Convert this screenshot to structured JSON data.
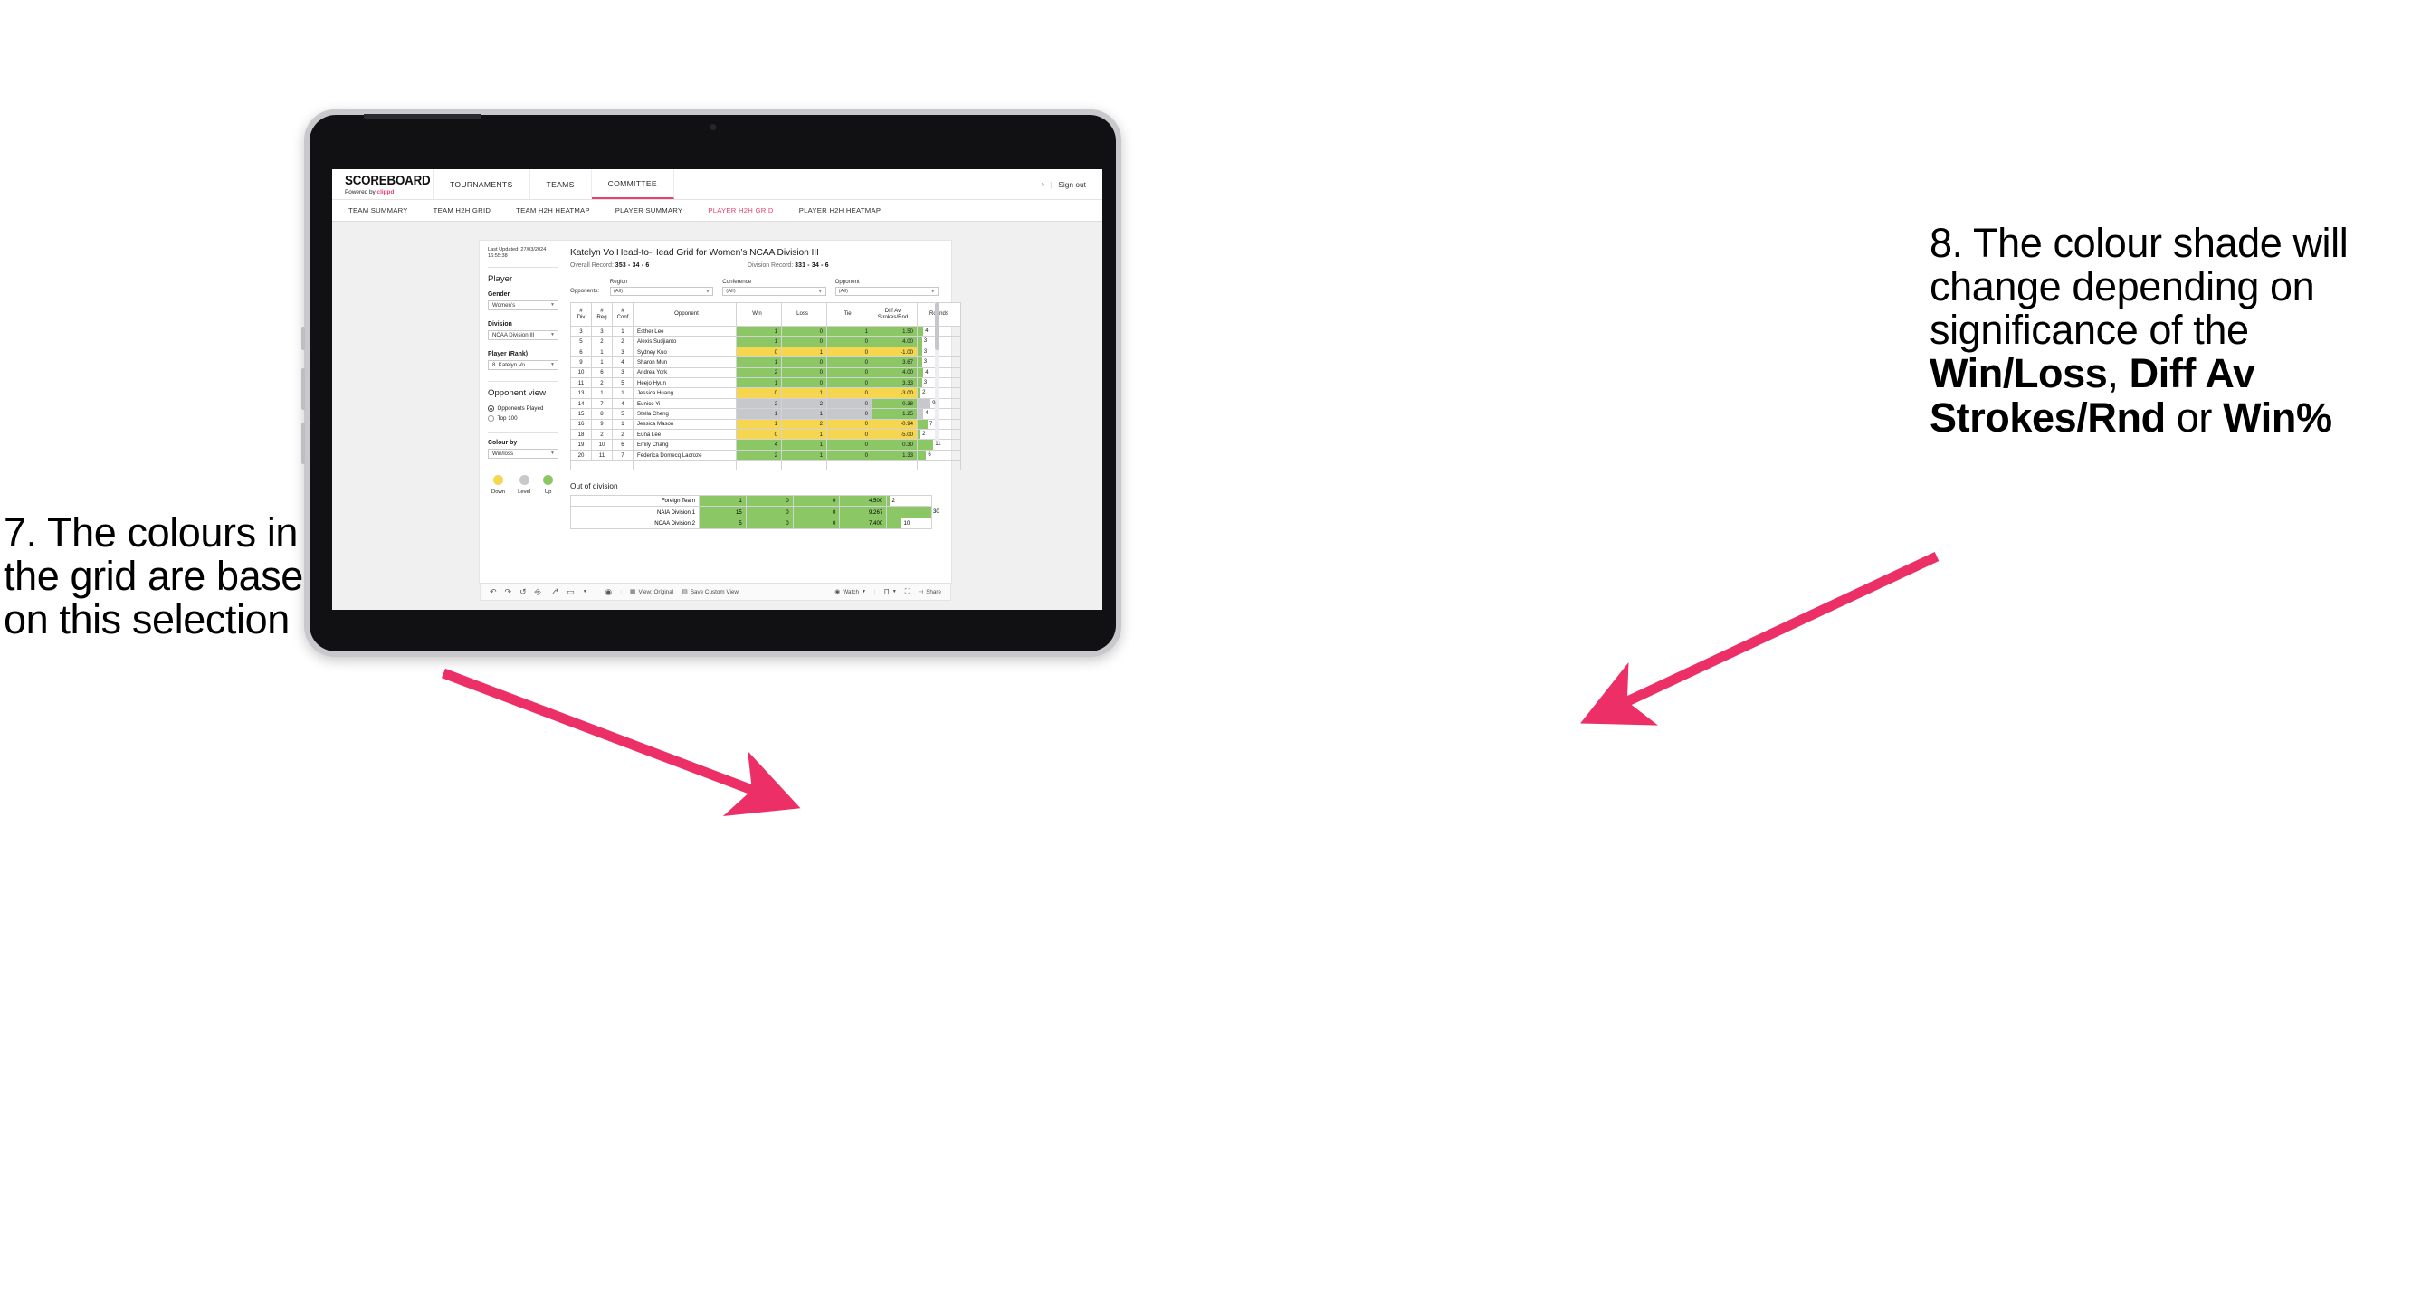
{
  "annotations": {
    "left": {
      "lines": [
        "7. The colours in",
        "the grid are based",
        "on this selection"
      ]
    },
    "right": {
      "segments": [
        {
          "text": "8. The colour shade will change depending on significance of the ",
          "bold": false
        },
        {
          "text": "Win/Loss",
          "bold": true
        },
        {
          "text": ", ",
          "bold": false
        },
        {
          "text": "Diff Av Strokes/Rnd",
          "bold": true
        },
        {
          "text": " or ",
          "bold": false
        },
        {
          "text": "Win%",
          "bold": true
        }
      ]
    },
    "arrow_color": "#ec2f66"
  },
  "app": {
    "brand": {
      "title": "SCOREBOARD",
      "powered_prefix": "Powered by ",
      "powered_name": "clippd"
    },
    "top_nav": [
      {
        "label": "TOURNAMENTS",
        "active": false
      },
      {
        "label": "TEAMS",
        "active": false
      },
      {
        "label": "COMMITTEE",
        "active": true
      }
    ],
    "top_right": {
      "chevron": "›",
      "separator": "|",
      "sign_out": "Sign out"
    },
    "sub_nav": [
      {
        "label": "TEAM SUMMARY",
        "active": false
      },
      {
        "label": "TEAM H2H GRID",
        "active": false
      },
      {
        "label": "TEAM H2H HEATMAP",
        "active": false
      },
      {
        "label": "PLAYER SUMMARY",
        "active": false
      },
      {
        "label": "PLAYER H2H GRID",
        "active": true
      },
      {
        "label": "PLAYER H2H HEATMAP",
        "active": false
      }
    ],
    "accent_color": "#e8416b"
  },
  "panel": {
    "last_updated_line1": "Last Updated: 27/03/2024",
    "last_updated_line2": "16:55:38",
    "heading": "Player",
    "fields": [
      {
        "label": "Gender",
        "value": "Women’s"
      },
      {
        "label": "Division",
        "value": "NCAA Division III"
      },
      {
        "label": "Player (Rank)",
        "value": "8. Katelyn Vo"
      }
    ],
    "opponent_view": {
      "heading": "Opponent view",
      "options": [
        {
          "label": "Opponents Played",
          "selected": true
        },
        {
          "label": "Top 100",
          "selected": false
        }
      ]
    },
    "colour_by": {
      "label": "Colour by",
      "value": "Win/loss"
    },
    "legend": [
      {
        "label": "Down",
        "color": "#f5d64e"
      },
      {
        "label": "Level",
        "color": "#c6c8cc"
      },
      {
        "label": "Up",
        "color": "#8cc765"
      }
    ]
  },
  "main": {
    "title": "Katelyn Vo Head-to-Head Grid for Women’s NCAA Division III",
    "overall_record_label": "Overall Record: ",
    "overall_record_value": "353 -  34 - 6",
    "division_record_label": "Division Record: ",
    "division_record_value": "331 -  34 - 6",
    "opponents_label": "Opponents:",
    "filters": [
      {
        "label": "Region",
        "value": "(All)"
      },
      {
        "label": "Conference",
        "value": "(All)"
      },
      {
        "label": "Opponent",
        "value": "(All)"
      }
    ]
  },
  "chart_data": {
    "type": "table",
    "title": "Katelyn Vo Head-to-Head Grid for Women’s NCAA Division III",
    "columns": [
      "# Div",
      "# Reg",
      "# Conf",
      "Opponent",
      "Win",
      "Loss",
      "Tie",
      "Diff Av Strokes/Rnd",
      "Rounds"
    ],
    "column_headers_multiline": [
      [
        "#",
        "Div"
      ],
      [
        "#",
        "Reg"
      ],
      [
        "#",
        "Conf"
      ],
      [
        "Opponent"
      ],
      [
        "Win"
      ],
      [
        "Loss"
      ],
      [
        "Tie"
      ],
      [
        "Diff Av",
        "Strokes/Rnd"
      ],
      [
        "Rounds"
      ]
    ],
    "rounds_max": 30,
    "rows": [
      {
        "div": "3",
        "reg": "3",
        "conf": "1",
        "opponent": "Esther Lee",
        "win": "1",
        "loss": "0",
        "tie": "1",
        "diff": "1.50",
        "rounds": "4",
        "shade": "up"
      },
      {
        "div": "5",
        "reg": "2",
        "conf": "2",
        "opponent": "Alexis Sudjianto",
        "win": "1",
        "loss": "0",
        "tie": "0",
        "diff": "4.00",
        "rounds": "3",
        "shade": "up"
      },
      {
        "div": "6",
        "reg": "1",
        "conf": "3",
        "opponent": "Sydney Kuo",
        "win": "0",
        "loss": "1",
        "tie": "0",
        "diff": "-1.00",
        "rounds": "3",
        "shade": "down"
      },
      {
        "div": "9",
        "reg": "1",
        "conf": "4",
        "opponent": "Sharon Mun",
        "win": "1",
        "loss": "0",
        "tie": "0",
        "diff": "3.67",
        "rounds": "3",
        "shade": "up"
      },
      {
        "div": "10",
        "reg": "6",
        "conf": "3",
        "opponent": "Andrea York",
        "win": "2",
        "loss": "0",
        "tie": "0",
        "diff": "4.00",
        "rounds": "4",
        "shade": "up"
      },
      {
        "div": "11",
        "reg": "2",
        "conf": "5",
        "opponent": "Heejo Hyun",
        "win": "1",
        "loss": "0",
        "tie": "0",
        "diff": "3.33",
        "rounds": "3",
        "shade": "up"
      },
      {
        "div": "13",
        "reg": "1",
        "conf": "1",
        "opponent": "Jessica Huang",
        "win": "0",
        "loss": "1",
        "tie": "0",
        "diff": "-3.00",
        "rounds": "2",
        "shade": "down"
      },
      {
        "div": "14",
        "reg": "7",
        "conf": "4",
        "opponent": "Eunice Yi",
        "win": "2",
        "loss": "2",
        "tie": "0",
        "diff": "0.38",
        "rounds": "9",
        "shade": "level",
        "diff_shade": "up"
      },
      {
        "div": "15",
        "reg": "8",
        "conf": "5",
        "opponent": "Stella Cheng",
        "win": "1",
        "loss": "1",
        "tie": "0",
        "diff": "1.25",
        "rounds": "4",
        "shade": "level",
        "diff_shade": "up"
      },
      {
        "div": "16",
        "reg": "9",
        "conf": "1",
        "opponent": "Jessica Mason",
        "win": "1",
        "loss": "2",
        "tie": "0",
        "diff": "-0.94",
        "rounds": "7",
        "shade": "down"
      },
      {
        "div": "18",
        "reg": "2",
        "conf": "2",
        "opponent": "Euna Lee",
        "win": "0",
        "loss": "1",
        "tie": "0",
        "diff": "-5.00",
        "rounds": "2",
        "shade": "down"
      },
      {
        "div": "19",
        "reg": "10",
        "conf": "6",
        "opponent": "Emily Chang",
        "win": "4",
        "loss": "1",
        "tie": "0",
        "diff": "0.30",
        "rounds": "11",
        "shade": "up"
      },
      {
        "div": "20",
        "reg": "11",
        "conf": "7",
        "opponent": "Federica Domecq Lacroze",
        "win": "2",
        "loss": "1",
        "tie": "0",
        "diff": "1.33",
        "rounds": "6",
        "shade": "up"
      }
    ],
    "out_of_division": {
      "title": "Out of division",
      "rows": [
        {
          "name": "Foreign Team",
          "win": "1",
          "loss": "0",
          "tie": "0",
          "diff": "4.500",
          "rounds": "2",
          "shade": "up"
        },
        {
          "name": "NAIA Division 1",
          "win": "15",
          "loss": "0",
          "tie": "0",
          "diff": "9.267",
          "rounds": "30",
          "shade": "up"
        },
        {
          "name": "NCAA Division 2",
          "win": "5",
          "loss": "0",
          "tie": "0",
          "diff": "7.400",
          "rounds": "10",
          "shade": "up"
        }
      ]
    },
    "colors": {
      "up": "#8cc765",
      "down": "#f5d64e",
      "level": "#c6c8cc",
      "bar": "#8cc765"
    }
  },
  "toolbar": {
    "icons": [
      "undo-icon",
      "redo-icon",
      "revert-icon",
      "refresh-icon",
      "pause-icon",
      "shape-icon",
      "caret-icon",
      "alert-icon"
    ],
    "view_label": "View: Original",
    "save_label": "Save Custom View",
    "watch_label": "Watch",
    "share_label": "Share"
  }
}
